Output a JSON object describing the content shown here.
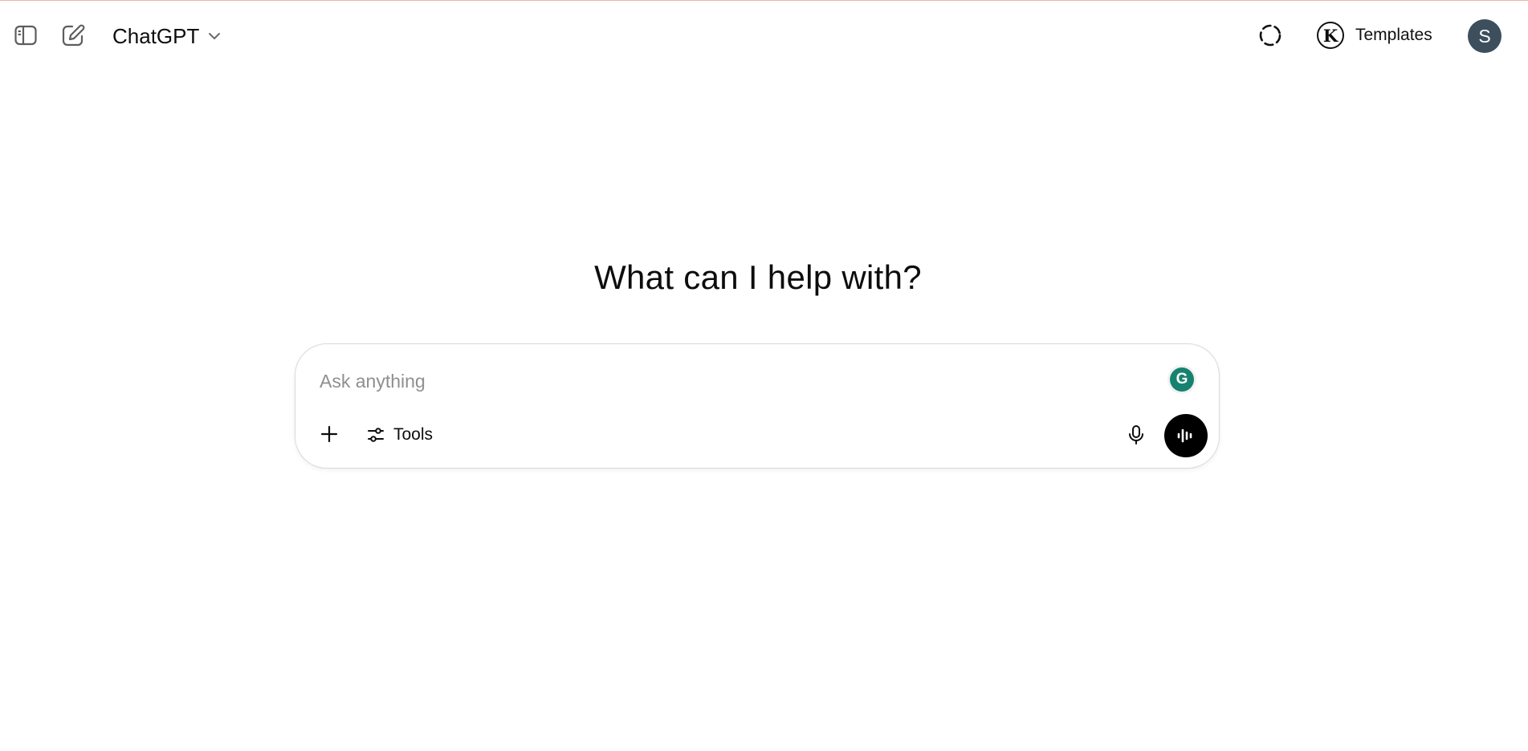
{
  "header": {
    "model_name": "ChatGPT",
    "templates_label": "Templates",
    "templates_badge_letter": "K",
    "avatar_initial": "S"
  },
  "main": {
    "headline": "What can I help with?"
  },
  "composer": {
    "placeholder": "Ask anything",
    "tools_label": "Tools",
    "grammarly_letter": "G"
  },
  "colors": {
    "avatar_bg": "#3d4f5c",
    "grammarly": "#15826f",
    "voice_button": "#000000"
  },
  "icons": {
    "sidebar_toggle": "sidebar-icon",
    "new_chat": "edit-icon",
    "model_chevron": "chevron-down-icon",
    "temporary_chat": "dashed-circle-icon",
    "attach": "plus-icon",
    "tools": "sliders-icon",
    "microphone": "mic-icon",
    "voice": "waveform-icon"
  }
}
